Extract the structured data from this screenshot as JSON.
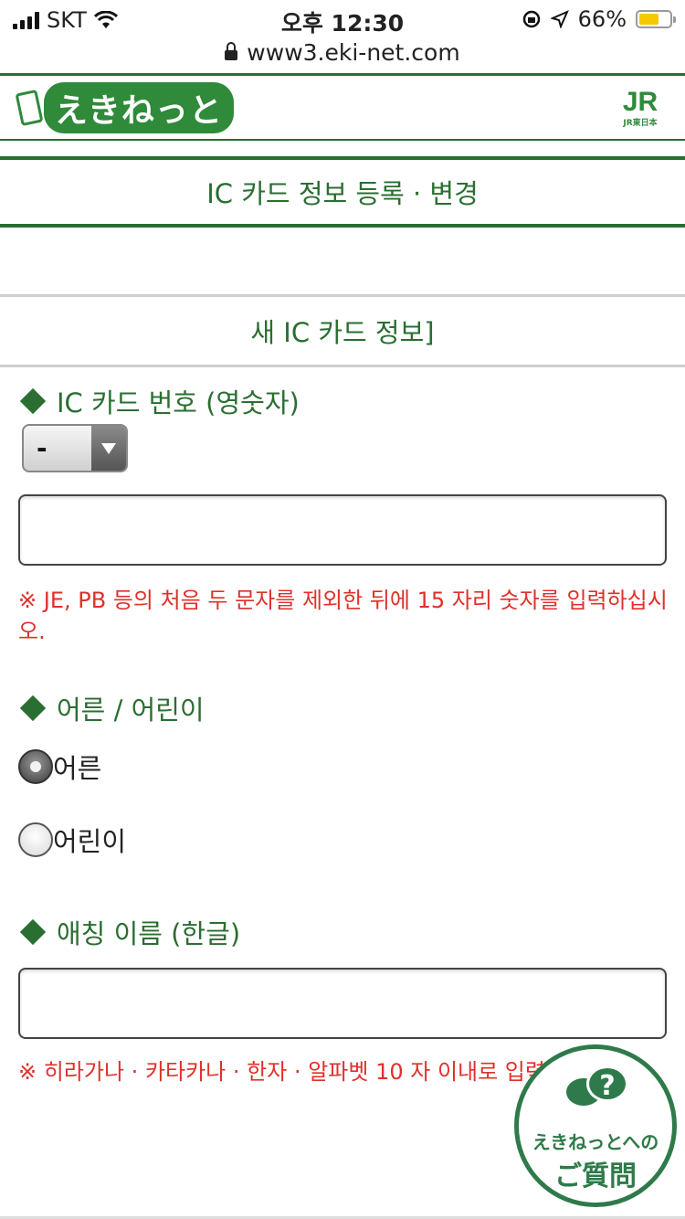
{
  "status_bar": {
    "carrier": "SKT",
    "time": "오후 12:30",
    "battery_percent": "66%",
    "battery_level": 0.66
  },
  "browser": {
    "url": "www3.eki-net.com"
  },
  "header": {
    "logo_text": "えきねっと",
    "jr_logo": "JR",
    "jr_sub": "JR東日本"
  },
  "page_title": "IC 카드 정보 등록 · 변경",
  "section_title": "새 IC 카드 정보]",
  "ic_card": {
    "label": "IC 카드 번호 (영숫자)",
    "prefix_select_value": "-",
    "number_value": "",
    "note": "※ JE, PB 등의 처음 두 문자를 제외한 뒤에 15 자리 숫자를 입력하십시오."
  },
  "age": {
    "label": "어른 / 어린이",
    "options": [
      {
        "label": "어른",
        "selected": true
      },
      {
        "label": "어린이",
        "selected": false
      }
    ]
  },
  "nickname": {
    "label": "애칭 이름 (한글)",
    "value": "",
    "note": "※ 히라가나 · 카타카나 · 한자 · 알파벳 10 자 이내로 입력"
  },
  "help_button": {
    "line1": "えきねっとへの",
    "line2": "ご質問",
    "symbol": "?"
  },
  "colors": {
    "brand_green": "#2a6e32",
    "note_red": "#e0302a"
  }
}
